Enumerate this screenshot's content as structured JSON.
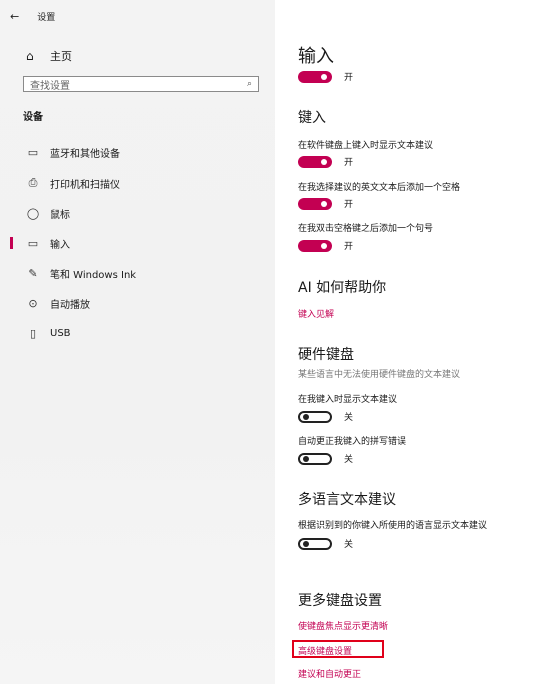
{
  "window": {
    "back_icon": "back-arrow-icon",
    "title": "设置"
  },
  "sidebar": {
    "home_label": "主页",
    "search_placeholder": "查找设置",
    "section_title": "设备",
    "items": [
      {
        "label": "蓝牙和其他设备",
        "icon": "bluetooth-icon"
      },
      {
        "label": "打印机和扫描仪",
        "icon": "printer-icon"
      },
      {
        "label": "鼠标",
        "icon": "mouse-icon"
      },
      {
        "label": "输入",
        "icon": "keyboard-icon",
        "active": true
      },
      {
        "label": "笔和 Windows Ink",
        "icon": "pen-icon"
      },
      {
        "label": "自动播放",
        "icon": "autoplay-icon"
      },
      {
        "label": "USB",
        "icon": "usb-icon"
      }
    ]
  },
  "main": {
    "title": "输入",
    "main_toggle_state": "开",
    "typing": {
      "heading": "键入",
      "settings": [
        {
          "label": "在软件键盘上键入时显示文本建议",
          "state": "开"
        },
        {
          "label": "在我选择建议的英文文本后添加一个空格",
          "state": "开"
        },
        {
          "label": "在我双击空格键之后添加一个句号",
          "state": "开"
        }
      ]
    },
    "ai": {
      "heading": "AI 如何帮助你",
      "link": "键入见解"
    },
    "hardware": {
      "heading": "硬件键盘",
      "subtitle": "某些语言中无法使用硬件键盘的文本建议",
      "settings": [
        {
          "label": "在我键入时显示文本建议",
          "state": "关"
        },
        {
          "label": "自动更正我键入的拼写错误",
          "state": "关"
        }
      ]
    },
    "multilingual": {
      "heading": "多语言文本建议",
      "label": "根据识别到的你键入所使用的语言显示文本建议",
      "state": "关"
    },
    "more": {
      "heading": "更多键盘设置",
      "links": [
        "使键盘焦点显示更清晰",
        "高级键盘设置",
        "建议和自动更正"
      ]
    }
  },
  "colors": {
    "accent": "#c30052",
    "highlight": "#e0001a"
  }
}
